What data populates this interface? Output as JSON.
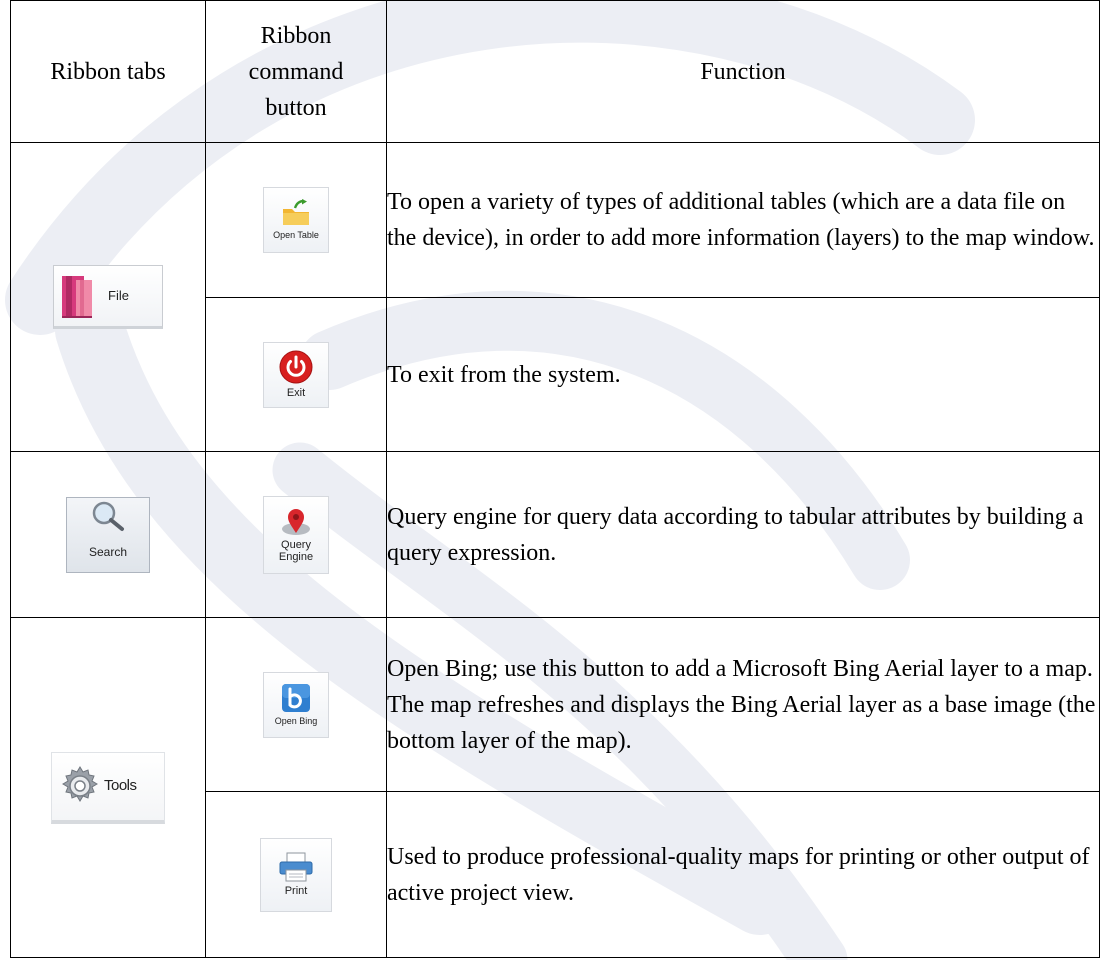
{
  "header": {
    "tabs": "Ribbon tabs",
    "button": [
      "Ribbon",
      "command",
      "button"
    ],
    "function": "Function"
  },
  "rows": [
    {
      "tab": "File",
      "button": "Open Table",
      "icon": "folder-icon",
      "function": "To open a variety of types of additional tables (which are a data file on the device), in order to add more information (layers) to the map window."
    },
    {
      "button": "Exit",
      "icon": "power-icon",
      "function": "To exit from the system."
    },
    {
      "tab": "Search",
      "button": [
        "Query",
        "Engine"
      ],
      "icon": "map-pin-icon",
      "function": "Query engine for query data according to tabular attributes by building a query expression."
    },
    {
      "tab": "Tools",
      "button": "Open Bing",
      "icon": "bing-icon",
      "function": "Open Bing; use this button to add a Microsoft Bing Aerial layer to a map. The map refreshes and displays the Bing Aerial layer as a base image (the bottom layer of the map)."
    },
    {
      "button": "Print",
      "icon": "printer-icon",
      "function": "Used to produce professional-quality maps for printing or other output of active project view."
    }
  ]
}
